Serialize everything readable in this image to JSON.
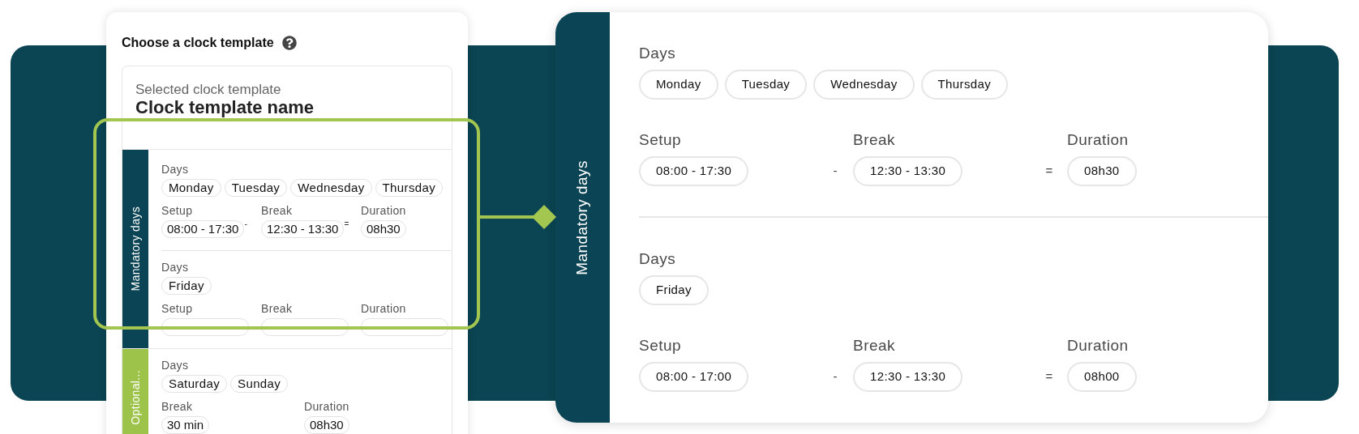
{
  "template_panel": {
    "title": "Choose a clock template",
    "selected_label": "Selected clock template",
    "template_name": "Clock template name",
    "sections": [
      {
        "label": "Mandatory days",
        "color": "#0b4555",
        "rows": [
          {
            "days_label": "Days",
            "days": [
              "Monday",
              "Tuesday",
              "Wednesday",
              "Thursday"
            ],
            "fields": [
              {
                "label": "Setup",
                "value": "08:00 - 17:30",
                "operator": "-"
              },
              {
                "label": "Break",
                "value": "12:30 - 13:30",
                "operator": "="
              },
              {
                "label": "Duration",
                "value": "08h30"
              }
            ]
          },
          {
            "days_label": "Days",
            "days": [
              "Friday"
            ],
            "fields": [
              {
                "label": "Setup"
              },
              {
                "label": "Break"
              },
              {
                "label": "Duration"
              }
            ]
          }
        ]
      },
      {
        "label": "Optional...",
        "color": "#9dc34a",
        "rows": [
          {
            "days_label": "Days",
            "days": [
              "Saturday",
              "Sunday"
            ],
            "fields": [
              {
                "label": "Break",
                "value": "30 min"
              },
              {
                "label": "Duration",
                "value": "08h30"
              }
            ]
          }
        ]
      }
    ]
  },
  "detail_panel": {
    "label": "Mandatory days",
    "rows": [
      {
        "days_label": "Days",
        "days": [
          "Monday",
          "Tuesday",
          "Wednesday",
          "Thursday"
        ],
        "fields": [
          {
            "label": "Setup",
            "value": "08:00 - 17:30",
            "operator": "-"
          },
          {
            "label": "Break",
            "value": "12:30 - 13:30",
            "operator": "="
          },
          {
            "label": "Duration",
            "value": "08h30"
          }
        ]
      },
      {
        "days_label": "Days",
        "days": [
          "Friday"
        ],
        "fields": [
          {
            "label": "Setup",
            "value": "08:00 - 17:00",
            "operator": "-"
          },
          {
            "label": "Break",
            "value": "12:30 - 13:30",
            "operator": "="
          },
          {
            "label": "Duration",
            "value": "08h00"
          }
        ]
      }
    ]
  }
}
